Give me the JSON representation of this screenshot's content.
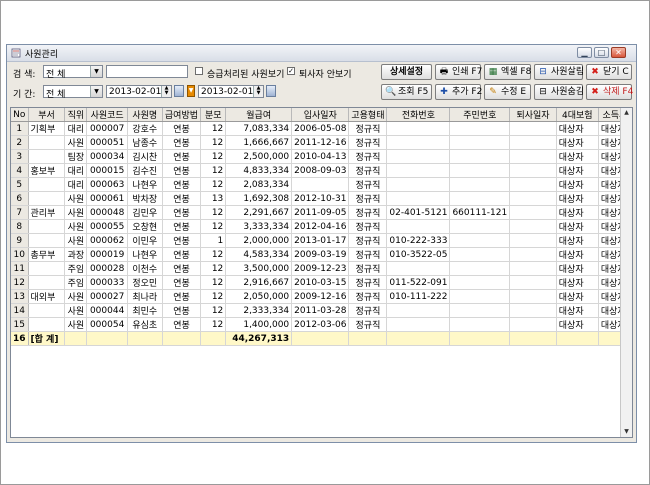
{
  "window": {
    "title": "사원관리"
  },
  "filters": {
    "search_label": "검 색:",
    "search_scope": "전      체",
    "search_value": "",
    "chk_inc_label": "승급처리된 사원보기",
    "chk_inc_checked": false,
    "chk_retired_label": "퇴사자 안보기",
    "chk_retired_checked": true,
    "period_label": "기 간:",
    "period_scope": "전      체",
    "date_from": "2013-02-01",
    "date_to": "2013-02-01"
  },
  "toolbar": {
    "detail_label": "상세설정",
    "print_label": "인쇄 F7",
    "excel_label": "엑셀 F8",
    "restore_label": "사원살림",
    "close_label": "닫기 C",
    "query_label": "조회 F5",
    "add_label": "추가 F2",
    "edit_label": "수정 E",
    "hide_label": "사원숨김",
    "delete_label": "삭제 F4"
  },
  "table": {
    "headers": [
      "No",
      "부서",
      "직위",
      "사원코드",
      "사원명",
      "급여방법",
      "분모",
      "월급여",
      "입사일자",
      "고용형태",
      "전화번호",
      "주민번호",
      "퇴사일자",
      "4대보험",
      "소득세"
    ],
    "rows": [
      [
        "1",
        "기획부",
        "대리",
        "000007",
        "강호수",
        "연봉",
        "12",
        "7,083,334",
        "2006-05-08",
        "정규직",
        "",
        "",
        "",
        "대상자",
        "대상자"
      ],
      [
        "2",
        "",
        "사원",
        "000051",
        "남종수",
        "연봉",
        "12",
        "1,666,667",
        "2011-12-16",
        "정규직",
        "",
        "",
        "",
        "대상자",
        "대상자"
      ],
      [
        "3",
        "",
        "팀장",
        "000034",
        "김시찬",
        "연봉",
        "12",
        "2,500,000",
        "2010-04-13",
        "정규직",
        "",
        "",
        "",
        "대상자",
        "대상자"
      ],
      [
        "4",
        "홍보부",
        "대리",
        "000015",
        "김수진",
        "연봉",
        "12",
        "4,833,334",
        "2008-09-03",
        "정규직",
        "",
        "",
        "",
        "대상자",
        "대상자"
      ],
      [
        "5",
        "",
        "대리",
        "000063",
        "나현우",
        "연봉",
        "12",
        "2,083,334",
        "",
        "정규직",
        "",
        "",
        "",
        "대상자",
        "대상자"
      ],
      [
        "6",
        "",
        "사원",
        "000061",
        "박차장",
        "연봉",
        "13",
        "1,692,308",
        "2012-10-31",
        "정규직",
        "",
        "",
        "",
        "대상자",
        "대상자"
      ],
      [
        "7",
        "관리부",
        "사원",
        "000048",
        "김민우",
        "연봉",
        "12",
        "2,291,667",
        "2011-09-05",
        "정규직",
        "02-401-5121",
        "660111-121",
        "",
        "대상자",
        "대상자"
      ],
      [
        "8",
        "",
        "사원",
        "000055",
        "오창현",
        "연봉",
        "12",
        "3,333,334",
        "2012-04-16",
        "정규직",
        "",
        "",
        "",
        "대상자",
        "대상자"
      ],
      [
        "9",
        "",
        "사원",
        "000062",
        "이민우",
        "연봉",
        "1",
        "2,000,000",
        "2013-01-17",
        "정규직",
        "010-222-333",
        "",
        "",
        "대상자",
        "대상자"
      ],
      [
        "10",
        "총무부",
        "과장",
        "000019",
        "나현우",
        "연봉",
        "12",
        "4,583,334",
        "2009-03-19",
        "정규직",
        "010-3522-05",
        "",
        "",
        "대상자",
        "대상자"
      ],
      [
        "11",
        "",
        "주임",
        "000028",
        "이천수",
        "연봉",
        "12",
        "3,500,000",
        "2009-12-23",
        "정규직",
        "",
        "",
        "",
        "대상자",
        "대상자"
      ],
      [
        "12",
        "",
        "주임",
        "000033",
        "정오민",
        "연봉",
        "12",
        "2,916,667",
        "2010-03-15",
        "정규직",
        "011-522-091",
        "",
        "",
        "대상자",
        "대상자"
      ],
      [
        "13",
        "대외부",
        "사원",
        "000027",
        "최나라",
        "연봉",
        "12",
        "2,050,000",
        "2009-12-16",
        "정규직",
        "010-111-222",
        "",
        "",
        "대상자",
        "대상자"
      ],
      [
        "14",
        "",
        "사원",
        "000044",
        "최민수",
        "연봉",
        "12",
        "2,333,334",
        "2011-03-28",
        "정규직",
        "",
        "",
        "",
        "대상자",
        "대상자"
      ],
      [
        "15",
        "",
        "사원",
        "000054",
        "유심초",
        "연봉",
        "12",
        "1,400,000",
        "2012-03-06",
        "정규직",
        "",
        "",
        "",
        "대상자",
        "대상자"
      ]
    ],
    "total": {
      "no": "16",
      "label": "[합 계]",
      "sum": "44,267,313"
    }
  },
  "colors": {
    "accent": "#e78a00",
    "total_bg": "#fff8c8",
    "header_bg": "#ece9e2"
  }
}
